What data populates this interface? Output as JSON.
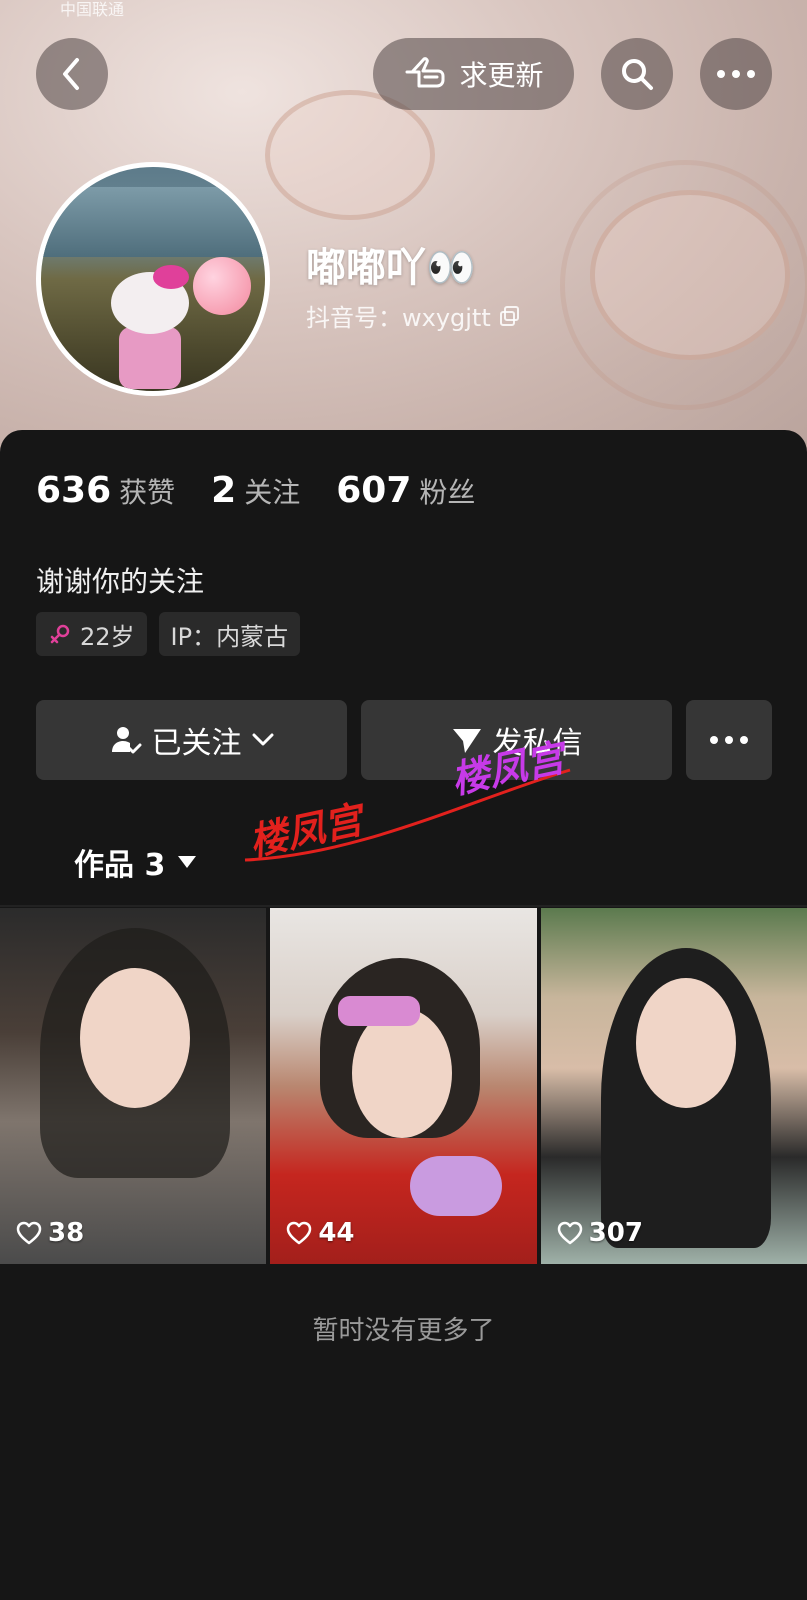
{
  "status_bar": {
    "carrier": "中国联通"
  },
  "header": {
    "update_label": "求更新"
  },
  "profile": {
    "name": "嘟嘟吖👀",
    "id_label": "抖音号：wxygjtt"
  },
  "stats": [
    {
      "num": "636",
      "label": "获赞"
    },
    {
      "num": "2",
      "label": "关注"
    },
    {
      "num": "607",
      "label": "粉丝"
    }
  ],
  "bio": "谢谢你的关注",
  "tags": {
    "age": "22岁",
    "ip": "IP：内蒙古"
  },
  "actions": {
    "follow": "已关注",
    "message": "发私信"
  },
  "watermarks": [
    "楼凤宫",
    "楼凤宫"
  ],
  "tabs": {
    "works": "作品 3"
  },
  "videos": [
    {
      "likes": "38"
    },
    {
      "likes": "44"
    },
    {
      "likes": "307"
    }
  ],
  "footer": "暂时没有更多了",
  "colors": {
    "background": "#161616",
    "button": "#363636",
    "accent_female": "#e0409a"
  }
}
